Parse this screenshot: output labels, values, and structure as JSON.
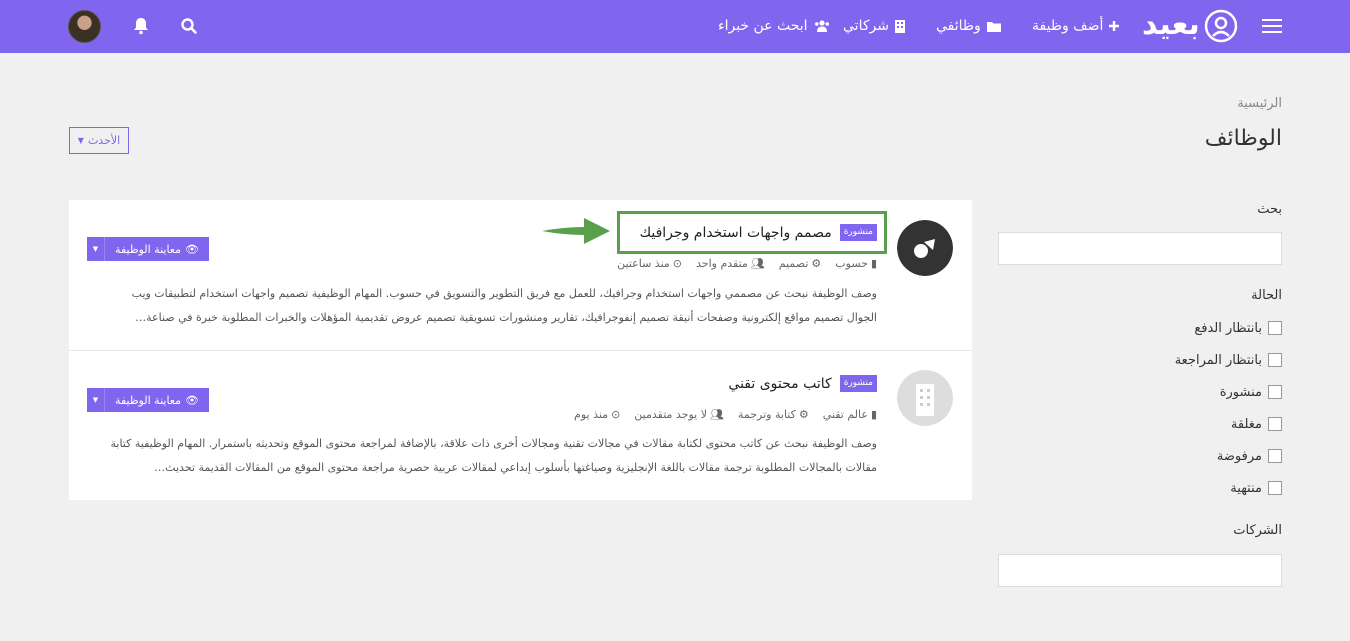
{
  "brand": {
    "name": "بعيد"
  },
  "nav": {
    "add_job": "أضف وظيفة",
    "my_jobs": "وظائفي",
    "my_companies": "شركاتي",
    "find_expert": "ابحث عن خبراء"
  },
  "breadcrumb": "الرئيسية",
  "page_title": "الوظائف",
  "sort": {
    "label": "الأحدث"
  },
  "sidebar": {
    "search_label": "بحث",
    "status_label": "الحالة",
    "statuses": [
      "بانتظار الدفع",
      "بانتظار المراجعة",
      "منشورة",
      "مغلقة",
      "مرفوضة",
      "منتهية"
    ],
    "companies_label": "الشركات"
  },
  "jobs": [
    {
      "status": "منشورة",
      "title": "مصمم واجهات استخدام وجرافيك",
      "company": "حسوب",
      "category": "تصميم",
      "applicants": "متقدم واحد",
      "time": "منذ ساعتين",
      "description": "وصف الوظيفة نبحث عن مصممي واجهات استخدام وجرافيك، للعمل مع فريق التطوير والتسويق في حسوب. المهام الوظيفية تصميم واجهات استخدام لتطبيقات ويب الجوال تصميم مواقع إلكترونية وصفحات أنيقة تصميم إنفوجرافيك، تقارير ومنشورات تسويقية تصميم عروض تقديمية المؤهلات والخبرات المطلوبة خبرة في صناعة…",
      "preview_label": "معاينة الوظيفة"
    },
    {
      "status": "منشورة",
      "title": "كاتب محتوى تقني",
      "company": "عالم تقني",
      "category": "كتابة وترجمة",
      "applicants": "لا يوجد متقدمين",
      "time": "منذ يوم",
      "description": "وصف الوظيفة نبحث عن كاتب محتوى لكتابة مقالات في مجالات تقنية ومجالات أخرى ذات علاقة، بالإضافة لمراجعة محتوى الموقع وتحديثه باستمرار. المهام الوظيفية كتابة مقالات بالمجالات المطلوبة ترجمة مقالات باللغة الإنجليزية وصياغتها بأسلوب إبداعي لمقالات عربية حصرية مراجعة محتوى الموقع من المقالات القديمة تحديث…",
      "preview_label": "معاينة الوظيفة"
    }
  ],
  "colors": {
    "accent": "#8066ee",
    "highlight": "#58a14a",
    "background": "#f0f0f0"
  }
}
